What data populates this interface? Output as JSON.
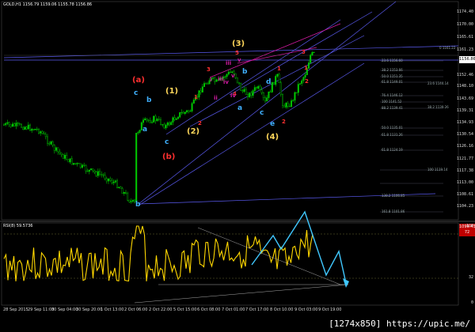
{
  "header": {
    "symbol": "GOLD,H1",
    "ohlc": "1156.79 1159.06 1155.78 1156.86"
  },
  "indicator": {
    "label": "RSI(8) 59.5736"
  },
  "price_axis": [
    "1174.40",
    "1170.00",
    "1165.61",
    "1161.23",
    "1156.85",
    "1152.46",
    "1148.10",
    "1143.69",
    "1139.31",
    "1134.93",
    "1130.54",
    "1126.16",
    "1121.77",
    "1117.38",
    "1113.00",
    "1108.61",
    "1104.23",
    "1099.85"
  ],
  "rsi_axis": [
    "100",
    "72",
    "32",
    "0"
  ],
  "price_boxes": {
    "current": "1156.86",
    "bottom": "1099.43",
    "rsi_level": "72"
  },
  "time_axis": [
    "28 Sep 2015",
    "29 Sep 11:00",
    "30 Sep 04:00",
    "30 Sep 20:00",
    "1 Oct 13:00",
    "2 Oct 06:00",
    "2 Oct 22:00",
    "5 Oct 15:00",
    "6 Oct 08:00",
    "7 Oct 01:00",
    "7 Oct 17:00",
    "8 Oct 10:00",
    "9 Oct 03:00",
    "9 Oct 19:00"
  ],
  "fib_levels": [
    "0  1161.22",
    "23.6 1156.60",
    "38.2 1153.66",
    "50.0 1151.35",
    "61.8 1149.01",
    "76.4 1146.12",
    "100 1141.52",
    "88.2 1139.41",
    "23.6 1144.14",
    "38.2 1139.26",
    "50.0 1135.01",
    "61.8 1131.26",
    "100 1119.14",
    "138.2 1106.85",
    "61.8 1124.19",
    "161.8 1101.86"
  ],
  "wave_labels": {
    "a_paren": "(a)",
    "b_paren": "(b)",
    "one_paren": "(1)",
    "two_paren": "(2)",
    "three_paren": "(3)",
    "four_paren": "(4)",
    "c1": "c",
    "a1": "a",
    "c2": "c",
    "b1": "b",
    "a2": "a",
    "b2": "b",
    "d1": "d",
    "c3": "c",
    "e1": "e",
    "b_low": "b",
    "r1": "1",
    "r2": "2",
    "r3": "3",
    "r4": "4",
    "r5": "5",
    "r6": "1",
    "r7": "2",
    "r8": "3",
    "r9": "1",
    "r10": "2",
    "m1": "i",
    "m2": "ii",
    "m3": "iii",
    "m4": "iv",
    "m5": "v",
    "m6": "iii",
    "m7": "iv",
    "m8": "v"
  },
  "watermark": "[1274x850] https://upic.me/",
  "colors": {
    "bull": "#00c800",
    "bear": "#00c800",
    "rsi": "#ffd700",
    "projection": "#40c8ff",
    "channel": "#5a5af0",
    "accent": "#d01aa0",
    "red": "#ff3030",
    "orange": "#ff7a00",
    "cyan": "#40b0ff",
    "yellow": "#ffd75a"
  }
}
